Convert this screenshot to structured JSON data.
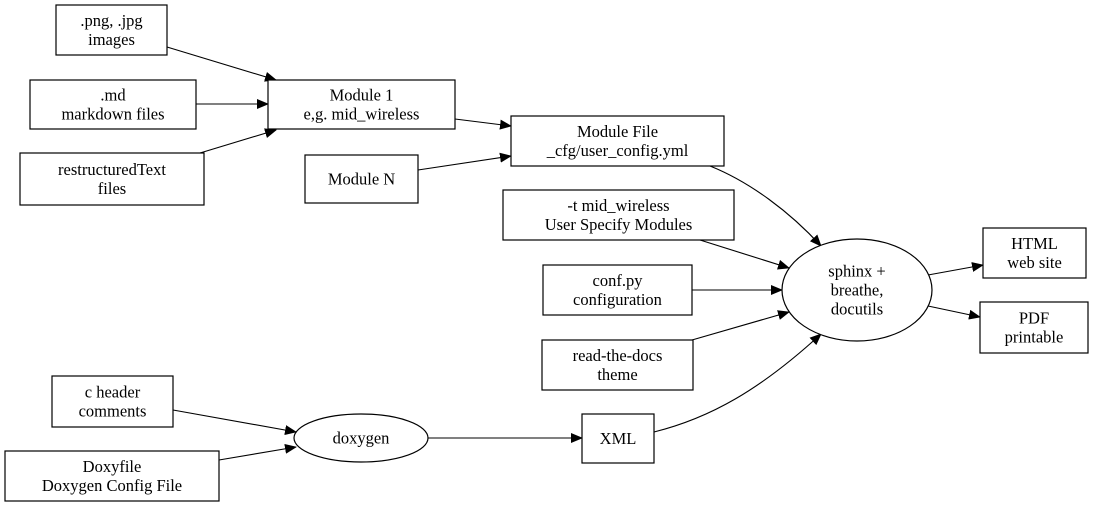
{
  "diagram": {
    "type": "graphviz-flowchart",
    "nodes": [
      {
        "id": "images",
        "shape": "box",
        "lines": [
          ".png, .jpg",
          "images"
        ]
      },
      {
        "id": "markdown",
        "shape": "box",
        "lines": [
          ".md",
          "markdown files"
        ]
      },
      {
        "id": "rst",
        "shape": "box",
        "lines": [
          "restructuredText",
          "files"
        ]
      },
      {
        "id": "module1",
        "shape": "box",
        "lines": [
          "Module 1",
          "e,g. mid_wireless"
        ]
      },
      {
        "id": "moduleN",
        "shape": "box",
        "lines": [
          "Module N"
        ]
      },
      {
        "id": "modulefile",
        "shape": "box",
        "lines": [
          "Module File",
          "_cfg/user_config.yml"
        ]
      },
      {
        "id": "usermodules",
        "shape": "box",
        "lines": [
          "-t mid_wireless",
          "User Specify Modules"
        ]
      },
      {
        "id": "confpy",
        "shape": "box",
        "lines": [
          "conf.py",
          "configuration"
        ]
      },
      {
        "id": "rtdtheme",
        "shape": "box",
        "lines": [
          "read-the-docs",
          "theme"
        ]
      },
      {
        "id": "sphinx",
        "shape": "ellipse",
        "lines": [
          "sphinx +",
          "breathe,",
          "docutils"
        ]
      },
      {
        "id": "html",
        "shape": "box",
        "lines": [
          "HTML",
          "web site"
        ]
      },
      {
        "id": "pdf",
        "shape": "box",
        "lines": [
          "PDF",
          "printable"
        ]
      },
      {
        "id": "cheader",
        "shape": "box",
        "lines": [
          "c header",
          "comments"
        ]
      },
      {
        "id": "doxyfile",
        "shape": "box",
        "lines": [
          "Doxyfile",
          "Doxygen Config File"
        ]
      },
      {
        "id": "doxygen",
        "shape": "ellipse",
        "lines": [
          "doxygen"
        ]
      },
      {
        "id": "xml",
        "shape": "box",
        "lines": [
          "XML"
        ]
      }
    ],
    "edges": [
      {
        "from": "images",
        "to": "module1"
      },
      {
        "from": "markdown",
        "to": "module1"
      },
      {
        "from": "rst",
        "to": "module1"
      },
      {
        "from": "module1",
        "to": "modulefile"
      },
      {
        "from": "moduleN",
        "to": "modulefile"
      },
      {
        "from": "modulefile",
        "to": "sphinx"
      },
      {
        "from": "usermodules",
        "to": "sphinx"
      },
      {
        "from": "confpy",
        "to": "sphinx"
      },
      {
        "from": "rtdtheme",
        "to": "sphinx"
      },
      {
        "from": "xml",
        "to": "sphinx"
      },
      {
        "from": "sphinx",
        "to": "html"
      },
      {
        "from": "sphinx",
        "to": "pdf"
      },
      {
        "from": "cheader",
        "to": "doxygen"
      },
      {
        "from": "doxyfile",
        "to": "doxygen"
      },
      {
        "from": "doxygen",
        "to": "xml"
      }
    ]
  }
}
